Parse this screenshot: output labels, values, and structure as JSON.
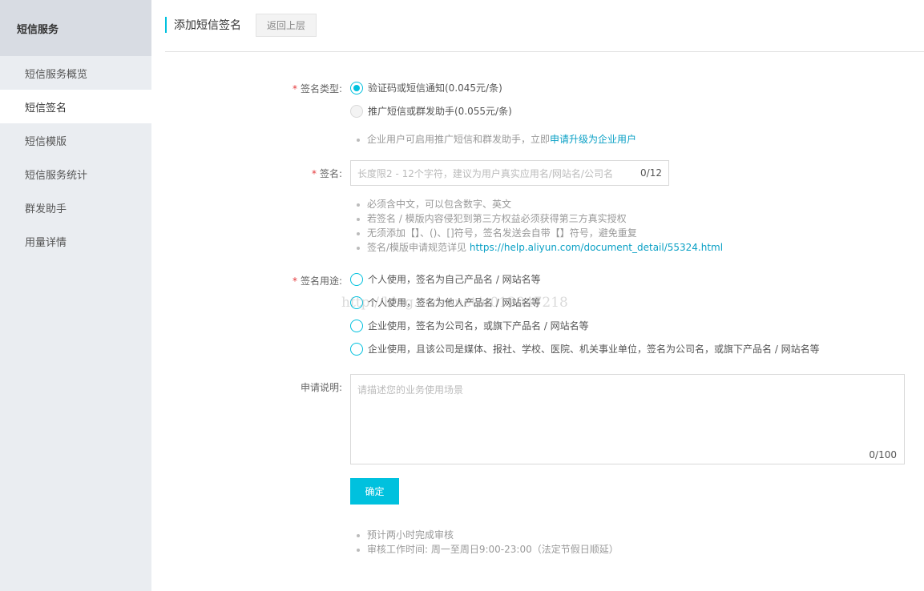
{
  "sidebar": {
    "header": "短信服务",
    "items": [
      {
        "label": "短信服务概览"
      },
      {
        "label": "短信签名"
      },
      {
        "label": "短信模版"
      },
      {
        "label": "短信服务统计"
      },
      {
        "label": "群发助手"
      },
      {
        "label": "用量详情"
      }
    ],
    "active_index": 1
  },
  "header": {
    "title": "添加短信签名",
    "back_label": "返回上层"
  },
  "form": {
    "sign_type": {
      "required_mark": "*",
      "label": "签名类型:",
      "options": [
        {
          "label": "验证码或短信通知(0.045元/条)",
          "checked": true,
          "disabled": false
        },
        {
          "label": "推广短信或群发助手(0.055元/条)",
          "checked": false,
          "disabled": true
        }
      ],
      "tip_text": "企业用户可启用推广短信和群发助手，立即",
      "tip_link": "申请升级为企业用户"
    },
    "sign_name": {
      "required_mark": "*",
      "label": "签名:",
      "placeholder": "长度限2 - 12个字符，建议为用户真实应用名/网站名/公司名",
      "counter": "0/12",
      "tips": [
        "必须含中文，可以包含数字、英文",
        "若签名 / 模版内容侵犯到第三方权益必须获得第三方真实授权",
        "无须添加【】、()、[]符号，签名发送会自带【】符号，避免重复"
      ],
      "spec_tip_text": "签名/模版申请规范详见 ",
      "spec_tip_link": "https://help.aliyun.com/document_detail/55324.html"
    },
    "sign_usage": {
      "required_mark": "*",
      "label": "签名用途:",
      "options": [
        {
          "label": "个人使用，签名为自己产品名 / 网站名等"
        },
        {
          "label": "个人使用，签名为他人产品名 / 网站名等"
        },
        {
          "label": "企业使用，签名为公司名，或旗下产品名 / 网站名等"
        },
        {
          "label": "企业使用，且该公司是媒体、报社、学校、医院、机关事业单位，签名为公司名，或旗下产品名 / 网站名等"
        }
      ]
    },
    "description": {
      "label": "申请说明:",
      "placeholder": "请描述您的业务使用场景",
      "counter": "0/100"
    },
    "confirm_label": "确定",
    "footer_tips": [
      "预计两小时完成审核",
      "审核工作时间: 周一至周日9:00-23:00（法定节假日顺延）"
    ]
  },
  "watermark": "http://blog.csdn.net/u012047218",
  "colors": {
    "accent": "#00c1de",
    "link": "#0aa0c5",
    "required": "#e4393c",
    "sidebar_bg": "#eaedf1"
  }
}
